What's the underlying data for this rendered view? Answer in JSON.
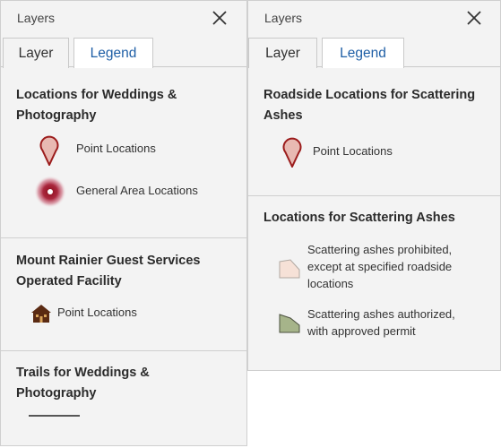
{
  "left_panel": {
    "title": "Layers",
    "tabs": [
      {
        "label": "Layer",
        "active": false
      },
      {
        "label": "Legend",
        "active": true
      }
    ],
    "sections": [
      {
        "title_lines": [
          "Locations for Weddings &",
          "Photography"
        ],
        "items": [
          {
            "label": "Point Locations",
            "icon": "map-pin-icon"
          },
          {
            "label": "General Area Locations",
            "icon": "area-glow-icon"
          }
        ]
      },
      {
        "title_lines": [
          "Mount Rainier Guest Services",
          "Operated Facility"
        ],
        "items": [
          {
            "label": "Point Locations",
            "icon": "lodge-icon"
          }
        ]
      },
      {
        "title_lines": [
          "Trails for Weddings &",
          "Photography"
        ],
        "items": [
          {
            "label": "",
            "icon": "trail-line-icon"
          }
        ]
      }
    ]
  },
  "right_panel": {
    "title": "Layers",
    "tabs": [
      {
        "label": "Layer",
        "active": false
      },
      {
        "label": "Legend",
        "active": true
      }
    ],
    "sections": [
      {
        "title_lines": [
          "Roadside Locations for Scattering",
          "Ashes"
        ],
        "items": [
          {
            "label": "Point Locations",
            "icon": "map-pin-icon"
          }
        ]
      },
      {
        "title_lines": [
          "Locations for Scattering Ashes"
        ],
        "items": [
          {
            "label_lines": [
              "Scattering ashes prohibited,",
              "except at specified roadside",
              "locations"
            ],
            "icon": "prohibited-area-icon"
          },
          {
            "label_lines": [
              "Scattering ashes authorized,",
              "with approved permit"
            ],
            "icon": "authorized-area-icon"
          }
        ]
      }
    ]
  },
  "colors": {
    "accent_tab": "#1f5fa6",
    "pin_red": "#9b1b1b",
    "pin_fill": "#e8b9b2",
    "glow_red": "#8b0d1a",
    "lodge_brown": "#5a2a12",
    "prohibited_fill": "#f6e1d7",
    "authorized_fill": "#a6b48a"
  }
}
